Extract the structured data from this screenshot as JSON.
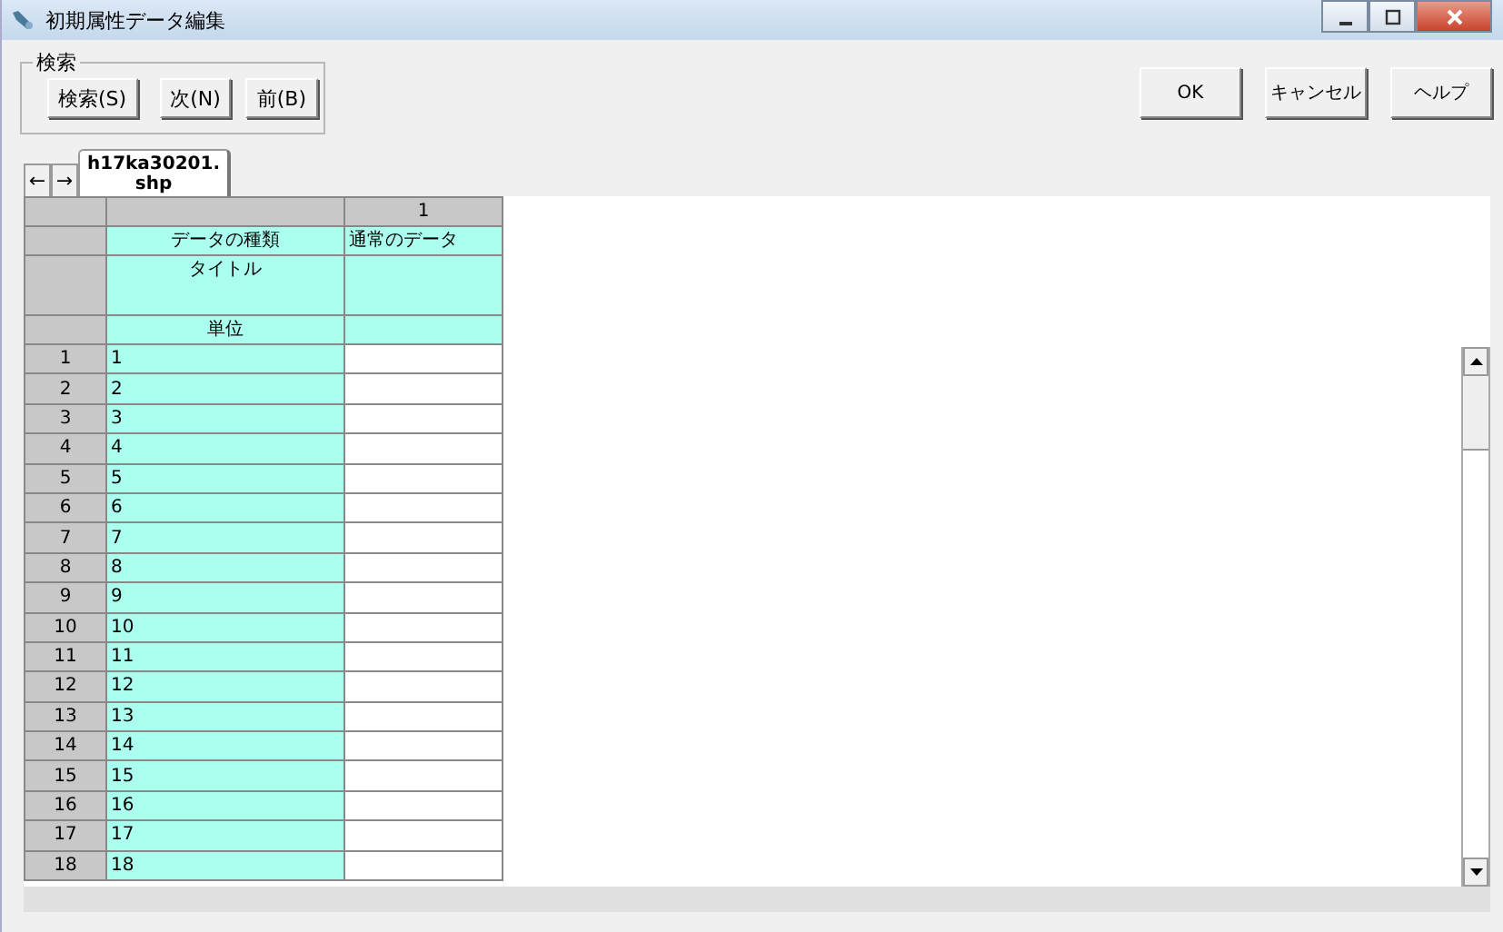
{
  "window": {
    "title": "初期属性データ編集"
  },
  "search": {
    "label": "検索",
    "buttons": [
      "検索(S)",
      "次(N)",
      "前(B)"
    ]
  },
  "dialog_buttons": [
    "OK",
    "キャンセル",
    "ヘルプ"
  ],
  "tabs": {
    "arrows": [
      "←",
      "→"
    ],
    "items": [
      {
        "label": "h17ka30201.\nshp",
        "selected": true
      }
    ]
  },
  "grid": {
    "column_header": "1",
    "meta_rows": [
      {
        "label": "データの種類",
        "value": "通常のデータ",
        "tall": false
      },
      {
        "label": "タイトル",
        "tall": true
      },
      {
        "label": "単位",
        "tall": false
      }
    ],
    "rows": [
      {
        "number": "1",
        "value": "1"
      },
      {
        "number": "2",
        "value": "2"
      },
      {
        "number": "3",
        "value": "3"
      },
      {
        "number": "4",
        "value": "4"
      },
      {
        "number": "5",
        "value": "5"
      },
      {
        "number": "6",
        "value": "6"
      },
      {
        "number": "7",
        "value": "7"
      },
      {
        "number": "8",
        "value": "8"
      },
      {
        "number": "9",
        "value": "9"
      },
      {
        "number": "10",
        "value": "10"
      },
      {
        "number": "11",
        "value": "11"
      },
      {
        "number": "12",
        "value": "12"
      },
      {
        "number": "13",
        "value": "13"
      },
      {
        "number": "14",
        "value": "14"
      },
      {
        "number": "15",
        "value": "15"
      },
      {
        "number": "16",
        "value": "16"
      },
      {
        "number": "17",
        "value": "17"
      },
      {
        "number": "18",
        "value": "18"
      }
    ]
  }
}
